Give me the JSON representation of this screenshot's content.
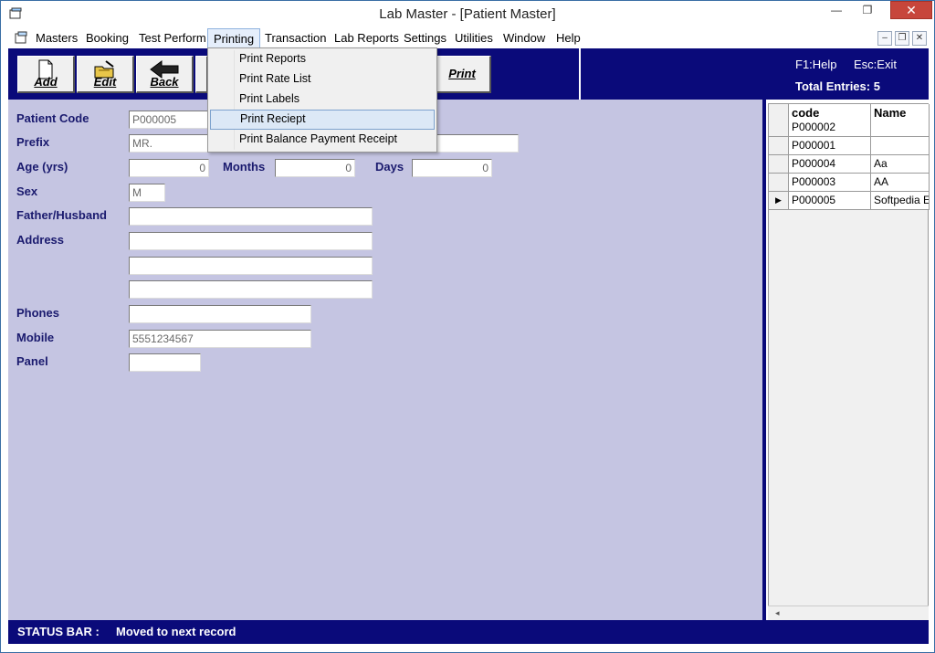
{
  "window": {
    "title": "Lab Master - [Patient Master]"
  },
  "titlebar": {
    "close_glyph": "✕"
  },
  "menubar": {
    "items": [
      "Masters",
      "Booking",
      "Test Perform",
      "Printing",
      "Transaction",
      "Lab Reports",
      "Settings",
      "Utilities",
      "Window",
      "Help"
    ],
    "active": "Printing"
  },
  "printing_menu": {
    "items": [
      "Print Reports",
      "Print Rate List",
      "Print Labels",
      "Print Reciept",
      "Print Balance Payment Receipt"
    ],
    "highlighted": "Print Reciept"
  },
  "toolbar": {
    "add_label": "Add",
    "edit_label": "Edit",
    "back_label": "Back",
    "print_label": "Print",
    "help_hint": "F1:Help",
    "exit_hint": "Esc:Exit",
    "total_entries": "Total Entries: 5"
  },
  "form": {
    "patient_code": {
      "label": "Patient Code",
      "value": "P000005"
    },
    "prefix": {
      "label": "Prefix",
      "value": "MR."
    },
    "age": {
      "label": "Age (yrs)",
      "value": "0"
    },
    "months": {
      "label": "Months",
      "value": "0"
    },
    "days": {
      "label": "Days",
      "value": "0"
    },
    "sex": {
      "label": "Sex",
      "value": "M"
    },
    "father_husband": {
      "label": "Father/Husband",
      "value": ""
    },
    "address": {
      "label": "Address",
      "line1": "",
      "line2": "",
      "line3": ""
    },
    "phones": {
      "label": "Phones",
      "value": ""
    },
    "mobile": {
      "label": "Mobile",
      "value": "5551234567"
    },
    "panel": {
      "label": "Panel",
      "value": ""
    }
  },
  "grid": {
    "columns": [
      "code",
      "Name"
    ],
    "rows": [
      {
        "code": "P000002",
        "name": ""
      },
      {
        "code": "P000001",
        "name": ""
      },
      {
        "code": "P000004",
        "name": "Aa"
      },
      {
        "code": "P000003",
        "name": "AA"
      },
      {
        "code": "P000005",
        "name": "Softpedia E"
      }
    ],
    "current_marker": "▶"
  },
  "statusbar": {
    "label": "STATUS BAR :",
    "message": "Moved to next record"
  },
  "icons": [
    "app-icon",
    "document-icon",
    "folder-edit-icon",
    "back-arrow-icon",
    "row-pointer-icon"
  ]
}
